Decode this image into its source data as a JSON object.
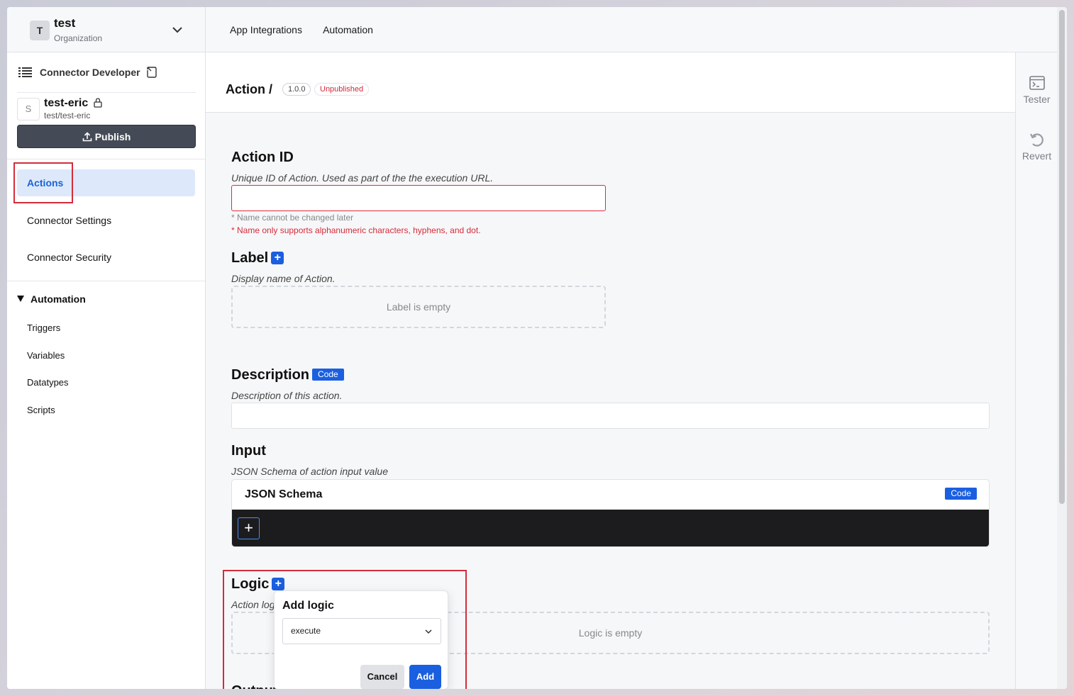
{
  "org": {
    "avatar_letter": "T",
    "name": "test",
    "subtitle": "Organization"
  },
  "topnav": {
    "items": [
      "App Integrations",
      "Automation"
    ]
  },
  "sidebar": {
    "section_title": "Connector Developer",
    "connector": {
      "avatar_letter": "S",
      "name": "test-eric",
      "path": "test/test-eric"
    },
    "publish_label": "Publish",
    "items": [
      {
        "label": "Actions",
        "active": true
      },
      {
        "label": "Connector Settings"
      },
      {
        "label": "Connector Security"
      }
    ],
    "automation": {
      "heading": "Automation",
      "items": [
        "Triggers",
        "Variables",
        "Datatypes",
        "Scripts"
      ]
    }
  },
  "main": {
    "breadcrumb": "Action /",
    "version": "1.0.0",
    "status": "Unpublished",
    "action_id": {
      "title": "Action ID",
      "description": "Unique ID of Action. Used as part of the the execution URL.",
      "value": "",
      "hint": "* Name cannot be changed later",
      "error": "* Name only supports alphanumeric characters, hyphens, and dot."
    },
    "label": {
      "title": "Label",
      "description": "Display name of Action.",
      "empty_text": "Label is empty"
    },
    "description": {
      "title": "Description",
      "tag": "Code",
      "description": "Description of this action.",
      "value": ""
    },
    "input": {
      "title": "Input",
      "description": "JSON Schema of action input value",
      "card_title": "JSON Schema",
      "tag": "Code"
    },
    "logic": {
      "title": "Logic",
      "description": "Action logic.",
      "empty_text": "Logic is empty"
    },
    "output": {
      "title": "Output"
    },
    "add_logic_popover": {
      "title": "Add logic",
      "selected": "execute",
      "cancel_label": "Cancel",
      "add_label": "Add"
    }
  },
  "right_panel": {
    "tester_label": "Tester",
    "revert_label": "Revert"
  },
  "colors": {
    "accent": "#1a5fe0",
    "error": "#d42c3a",
    "active_bg": "#dde9fb"
  }
}
